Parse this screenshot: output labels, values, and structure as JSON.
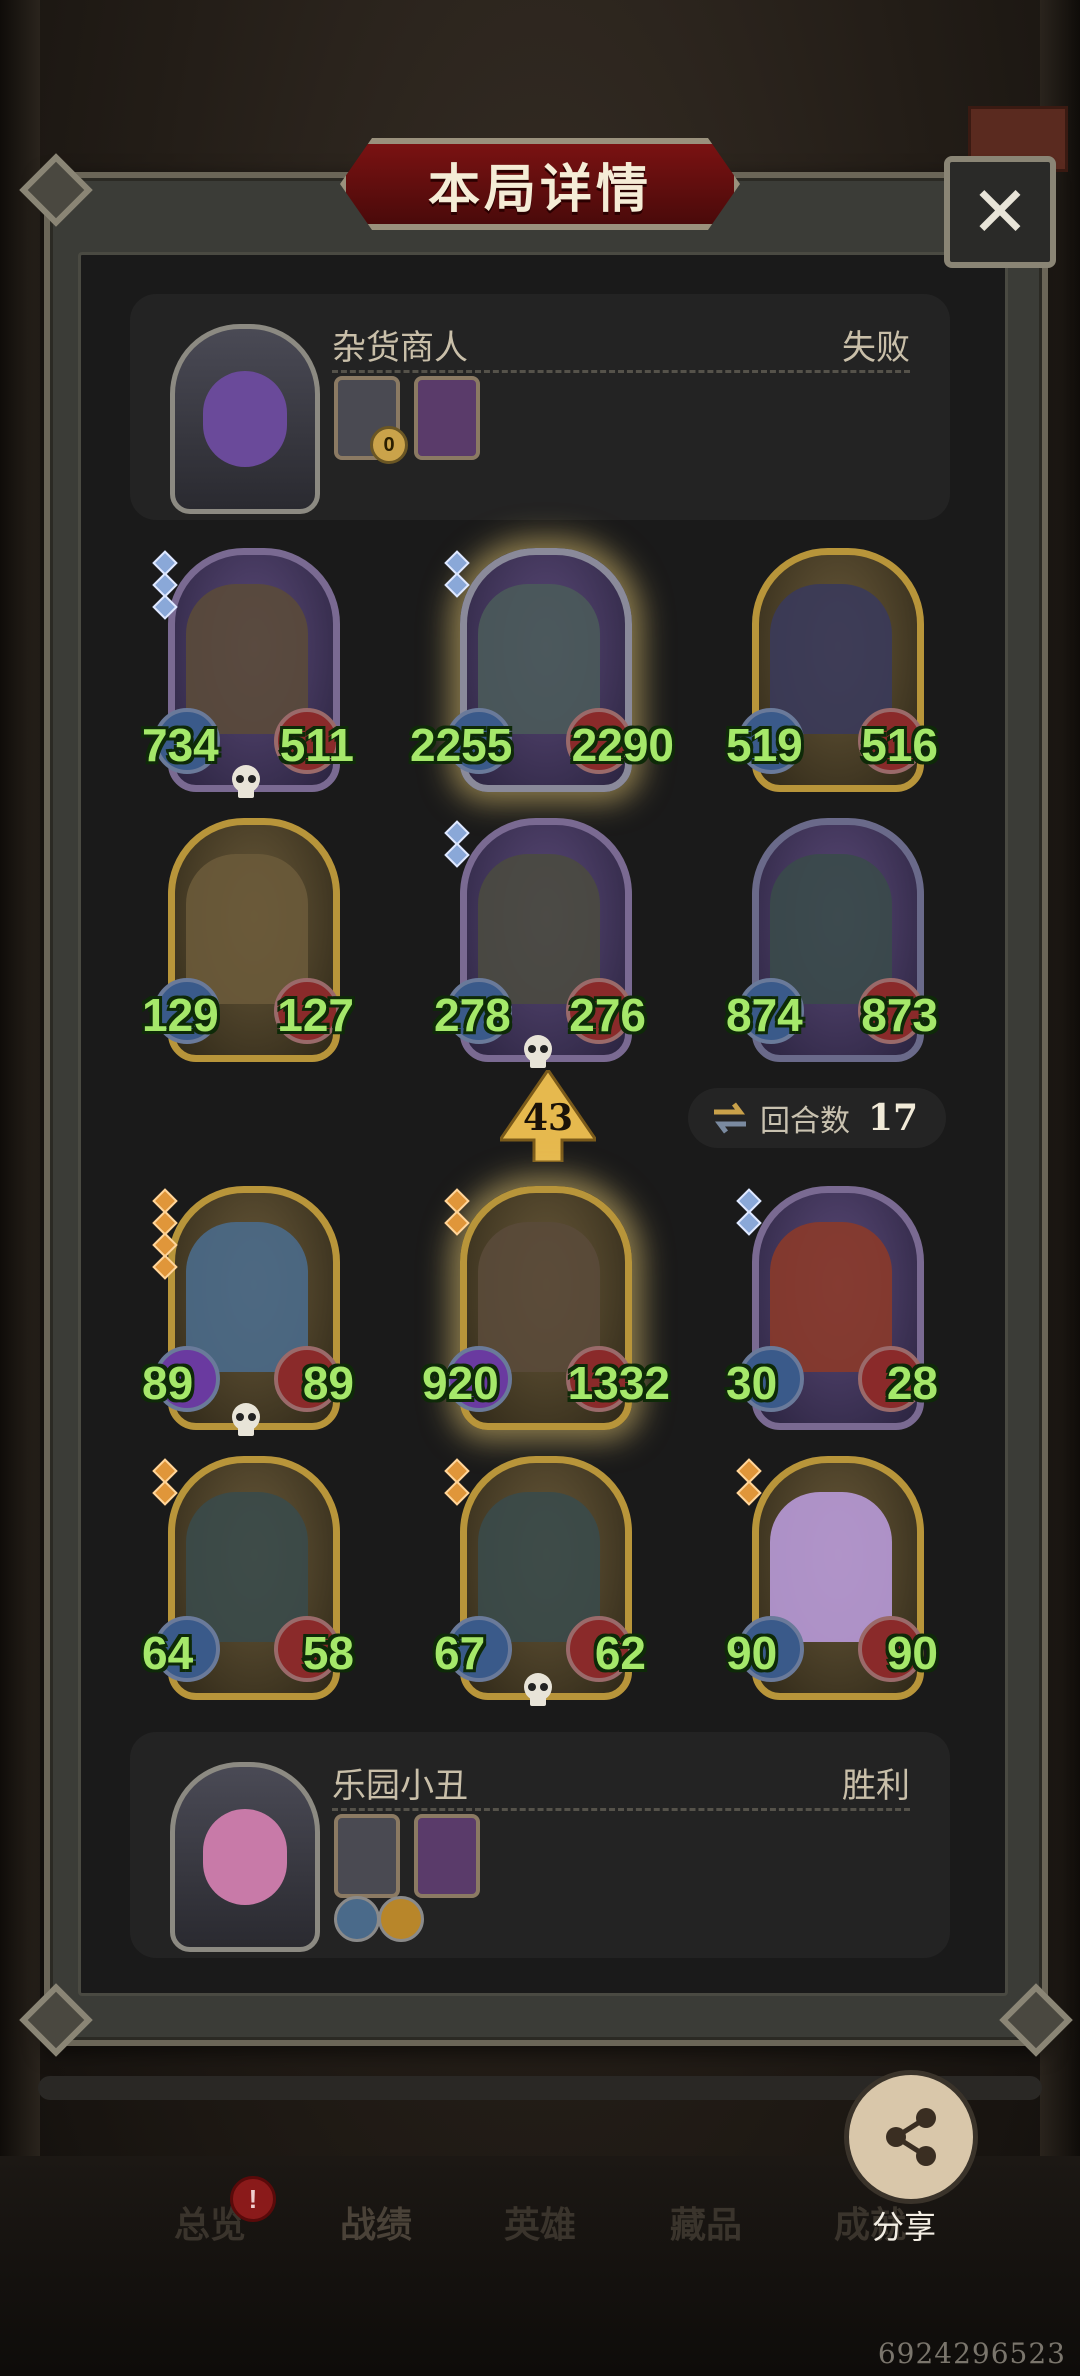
{
  "title": "本局详情",
  "opponent": {
    "name": "杂货商人",
    "result": "失败",
    "relic_badge": "0"
  },
  "player": {
    "name": "乐园小丑",
    "result": "胜利"
  },
  "enemy_units": [
    {
      "atk": "734",
      "hp": "511"
    },
    {
      "atk": "2255",
      "hp": "2290"
    },
    {
      "atk": "519",
      "hp": "516"
    },
    {
      "atk": "129",
      "hp": "127"
    },
    {
      "atk": "278",
      "hp": "276"
    },
    {
      "atk": "874",
      "hp": "873"
    }
  ],
  "player_units": [
    {
      "atk": "89",
      "hp": "89"
    },
    {
      "atk": "920",
      "hp": "1332"
    },
    {
      "atk": "30",
      "hp": "28"
    },
    {
      "atk": "64",
      "hp": "58"
    },
    {
      "atk": "67",
      "hp": "62"
    },
    {
      "atk": "90",
      "hp": "90"
    }
  ],
  "damage": "43",
  "turns": {
    "label": "回合数",
    "value": "17"
  },
  "share_label": "分享",
  "tabs": [
    "总览",
    "战绩",
    "英雄",
    "藏品",
    "成就"
  ],
  "alert_mark": "!",
  "uid": "6924296523",
  "colors": {
    "stat_green": "#a5e86a",
    "title_red": "#7a1212",
    "gold_frame": "#b8953a"
  }
}
